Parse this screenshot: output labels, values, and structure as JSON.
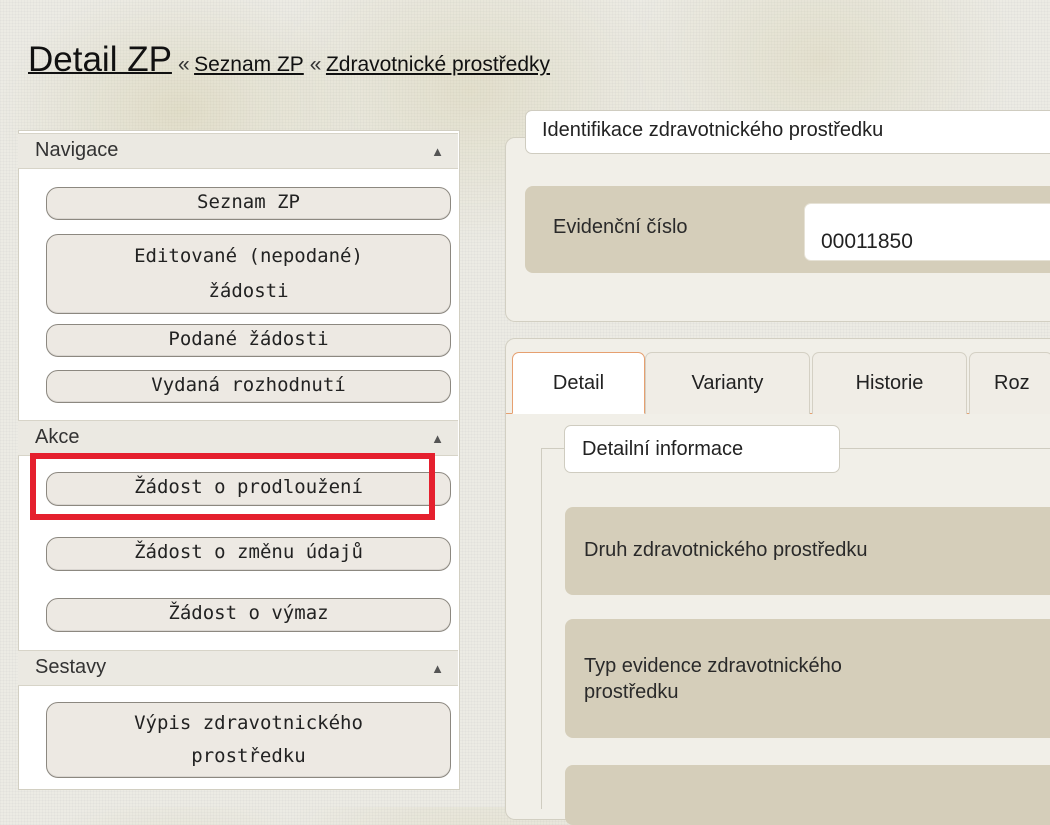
{
  "header": {
    "title": "Detail ZP",
    "separator": "«",
    "breadcrumb": [
      "Seznam ZP",
      "Zdravotnické prostředky"
    ]
  },
  "sidebar": {
    "arrow": "▲",
    "sections": [
      {
        "label": "Navigace",
        "buttons": [
          "Seznam ZP",
          "Editované (nepodané)",
          "žádosti",
          "Podané žádosti",
          "Vydaná rozhodnutí"
        ]
      },
      {
        "label": "Akce",
        "buttons": [
          "Žádost o prodloužení",
          "Žádost o změnu údajů",
          "Žádost o výmaz"
        ]
      },
      {
        "label": "Sestavy",
        "buttons": [
          "Výpis zdravotnického",
          "prostředku"
        ]
      }
    ]
  },
  "identification": {
    "legend": "Identifikace zdravotnického prostředku",
    "field_label": "Evidenční číslo",
    "field_value": "00011850"
  },
  "tabs": [
    "Detail",
    "Varianty",
    "Historie",
    "Roz"
  ],
  "detail": {
    "legend": "Detailní informace",
    "rows": [
      "Druh zdravotnického prostředku",
      "Typ evidence zdravotnického",
      "prostředku"
    ]
  },
  "colors": {
    "highlight": "#e5202e",
    "accent_tab": "#e6a070",
    "row_bg": "#d5ceba"
  }
}
